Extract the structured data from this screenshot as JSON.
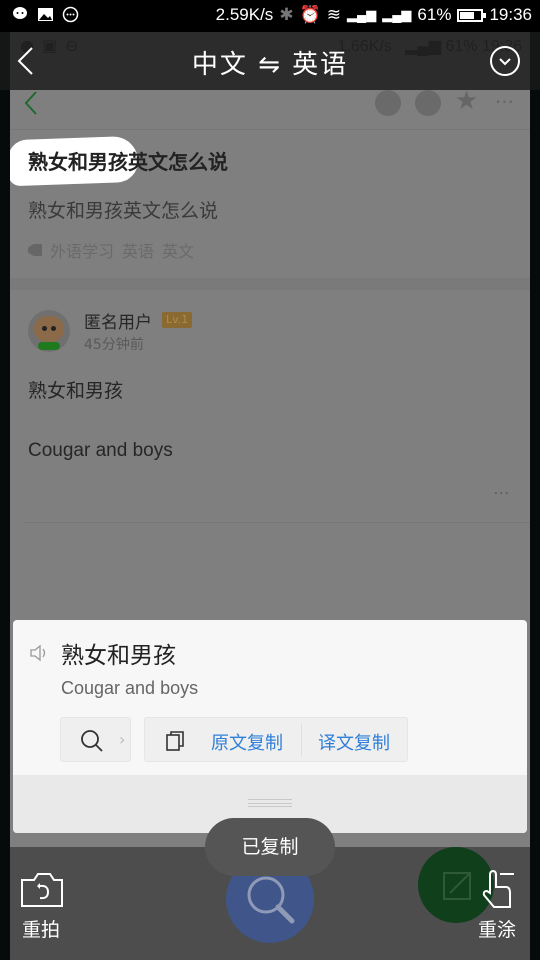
{
  "status_bar": {
    "net_speed": "2.59K/s",
    "battery": "61%",
    "battery_level": 0.61,
    "time": "19:36",
    "icons": [
      "wechat-icon",
      "image-icon",
      "message-icon",
      "bluetooth-icon",
      "alarm-icon",
      "wifi-icon",
      "signal-icon",
      "signal-icon-2"
    ]
  },
  "ghost_status": {
    "net_speed": "1.66K/s",
    "battery": "61%",
    "time": "19:36"
  },
  "header": {
    "title": "中文 ⇋ 英语",
    "back_icon": "chevron-left-icon",
    "dropdown_icon": "chevron-down-circle-icon"
  },
  "question": {
    "title": "熟女和男孩英文怎么说",
    "description": "熟女和男孩英文怎么说",
    "tags": [
      "外语学习",
      "英语",
      "英文"
    ]
  },
  "answer": {
    "user": "匿名用户",
    "level": "Lv.1",
    "time": "45分钟前",
    "line1": "熟女和男孩",
    "line2": "Cougar and boys",
    "more": "···"
  },
  "translation_card": {
    "source": "熟女和男孩",
    "translation": "Cougar and boys",
    "copy_source": "原文复制",
    "copy_translation": "译文复制"
  },
  "toast": "已复制",
  "bottom_bar": {
    "retake_label": "重拍",
    "redo_label": "重涂"
  },
  "colors": {
    "link_blue": "#2f7fd8",
    "fab_blue": "#40558a",
    "fab_green": "#103f1c"
  }
}
